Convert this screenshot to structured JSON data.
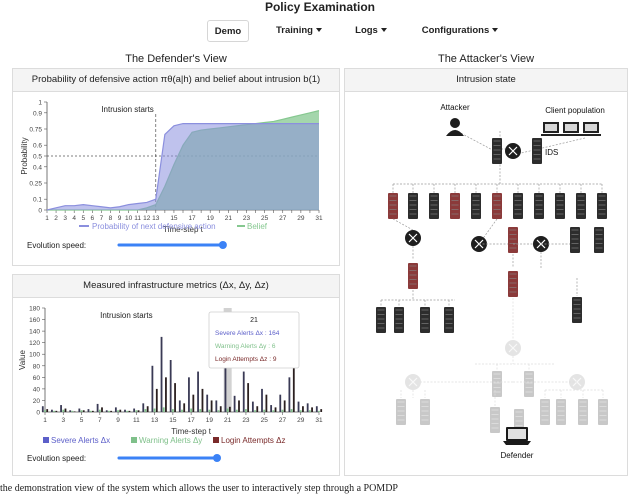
{
  "app": {
    "title": "Policy Examination"
  },
  "nav": {
    "tabs": [
      {
        "label": "Demo",
        "active": true
      },
      {
        "label": "Training",
        "dropdown": true
      },
      {
        "label": "Logs",
        "dropdown": true
      },
      {
        "label": "Configurations",
        "dropdown": true
      }
    ]
  },
  "defender_view": {
    "title": "The Defender's View",
    "belief_panel": {
      "title": "Probability of defensive action πθ(a|h) and belief about intrusion b(1)",
      "evolution_speed_label": "Evolution speed:",
      "evolution_speed": 0.98,
      "colors": {
        "action": "#8b8fde",
        "belief": "#86c890"
      }
    },
    "metrics_panel": {
      "title": "Measured infrastructure metrics (Δx, Δy, Δz)",
      "evolution_speed_label": "Evolution speed:",
      "evolution_speed": 0.98,
      "colors": {
        "severe": "#5c5fc9",
        "warning": "#7fc08a",
        "login": "#7a2a2a"
      },
      "tooltip": {
        "title": "21",
        "severe": "Severe Alerts Δx : 164",
        "warning": "Warning Alerts Δy : 6",
        "login": "Login Attempts Δz : 9"
      }
    }
  },
  "attacker_view": {
    "title": "The Attacker's View",
    "panel_title": "Intrusion state",
    "labels": {
      "attacker": "Attacker",
      "clients": "Client population",
      "ids": "IDS",
      "defender": "Defender"
    },
    "colors": {
      "compromised": "#8b3a3a",
      "server": "#2d2d2d",
      "link": "#9a9a9a",
      "unreachable": "#c8c8c8"
    }
  },
  "footer": {
    "caption": "the demonstration view of the system which allows the user to interactively step through a POMDP"
  },
  "chart_data": [
    {
      "type": "line",
      "title": "",
      "xlabel": "Time-step t",
      "ylabel": "Probability",
      "xlim": [
        1,
        31
      ],
      "ylim": [
        0,
        1
      ],
      "xticks": [
        1,
        2,
        3,
        4,
        5,
        6,
        7,
        8,
        9,
        10,
        11,
        12,
        13,
        14,
        15,
        16,
        17,
        18,
        19,
        20,
        21,
        22,
        23,
        24,
        25,
        26,
        27,
        28,
        29,
        30,
        31
      ],
      "xtick_labels_shown": [
        1,
        2,
        3,
        4,
        5,
        6,
        7,
        8,
        9,
        10,
        11,
        12,
        13,
        15,
        17,
        19,
        21,
        23,
        25,
        27,
        29,
        31
      ],
      "yticks": [
        0,
        0.1,
        0.25,
        0.4,
        0.5,
        0.6,
        0.75,
        0.9,
        1
      ],
      "grid": false,
      "legend": "bottom",
      "annotations": [
        {
          "text": "Intrusion starts",
          "x": 13
        },
        {
          "text": "",
          "y": 0.5,
          "style": "dashed"
        }
      ],
      "series": [
        {
          "name": "Probability of next defensive action",
          "x": [
            1,
            2,
            3,
            4,
            5,
            6,
            7,
            8,
            9,
            10,
            11,
            12,
            13,
            14,
            15,
            16,
            17,
            18,
            19,
            20,
            21,
            22,
            23,
            24,
            25,
            26,
            27,
            28,
            29,
            30,
            31
          ],
          "y": [
            0,
            0.02,
            0.04,
            0.04,
            0.05,
            0.04,
            0.03,
            0.02,
            0.03,
            0.05,
            0.06,
            0.07,
            0.1,
            0.7,
            0.78,
            0.8,
            0.8,
            0.8,
            0.8,
            0.8,
            0.8,
            0.8,
            0.8,
            0.8,
            0.8,
            0.8,
            0.8,
            0.8,
            0.8,
            0.8,
            0.8
          ]
        },
        {
          "name": "Belief",
          "x": [
            1,
            2,
            3,
            4,
            5,
            6,
            7,
            8,
            9,
            10,
            11,
            12,
            13,
            14,
            15,
            16,
            17,
            18,
            19,
            20,
            21,
            22,
            23,
            24,
            25,
            26,
            27,
            28,
            29,
            30,
            31
          ],
          "y": [
            0,
            0,
            0,
            0,
            0,
            0,
            0,
            0,
            0,
            0,
            0,
            0.02,
            0.05,
            0.22,
            0.42,
            0.6,
            0.72,
            0.74,
            0.75,
            0.76,
            0.77,
            0.78,
            0.79,
            0.8,
            0.81,
            0.82,
            0.84,
            0.86,
            0.88,
            0.9,
            0.92
          ]
        }
      ]
    },
    {
      "type": "bar",
      "title": "",
      "xlabel": "Time-step t",
      "ylabel": "Value",
      "xlim": [
        1,
        31
      ],
      "ylim": [
        0,
        180
      ],
      "xticks": [
        1,
        3,
        5,
        7,
        9,
        11,
        13,
        15,
        17,
        19,
        21,
        23,
        25,
        27,
        29,
        31
      ],
      "yticks": [
        0,
        20,
        40,
        60,
        80,
        100,
        120,
        140,
        160,
        180
      ],
      "grid": false,
      "legend": "bottom",
      "annotations": [
        {
          "text": "Intrusion starts",
          "x": 13
        }
      ],
      "highlight_x": 21,
      "categories": [
        1,
        2,
        3,
        4,
        5,
        6,
        7,
        8,
        9,
        10,
        11,
        12,
        13,
        14,
        15,
        16,
        17,
        18,
        19,
        20,
        21,
        22,
        23,
        24,
        25,
        26,
        27,
        28,
        29,
        30,
        31
      ],
      "series": [
        {
          "name": "Severe Alerts Δx",
          "values": [
            10,
            4,
            12,
            3,
            6,
            5,
            14,
            3,
            8,
            4,
            6,
            15,
            80,
            130,
            90,
            20,
            60,
            70,
            30,
            20,
            164,
            28,
            70,
            18,
            40,
            12,
            30,
            60,
            18,
            15,
            10
          ]
        },
        {
          "name": "Warning Alerts Δy",
          "values": [
            3,
            2,
            4,
            2,
            3,
            2,
            4,
            2,
            3,
            2,
            3,
            5,
            6,
            8,
            5,
            4,
            6,
            5,
            4,
            3,
            6,
            4,
            5,
            3,
            4,
            3,
            4,
            5,
            3,
            3,
            2
          ]
        },
        {
          "name": "Login Attempts Δz",
          "values": [
            5,
            2,
            6,
            1,
            3,
            2,
            8,
            2,
            4,
            2,
            3,
            10,
            40,
            60,
            50,
            15,
            30,
            40,
            20,
            10,
            9,
            20,
            50,
            10,
            30,
            8,
            20,
            100,
            10,
            8,
            5
          ]
        }
      ]
    }
  ]
}
